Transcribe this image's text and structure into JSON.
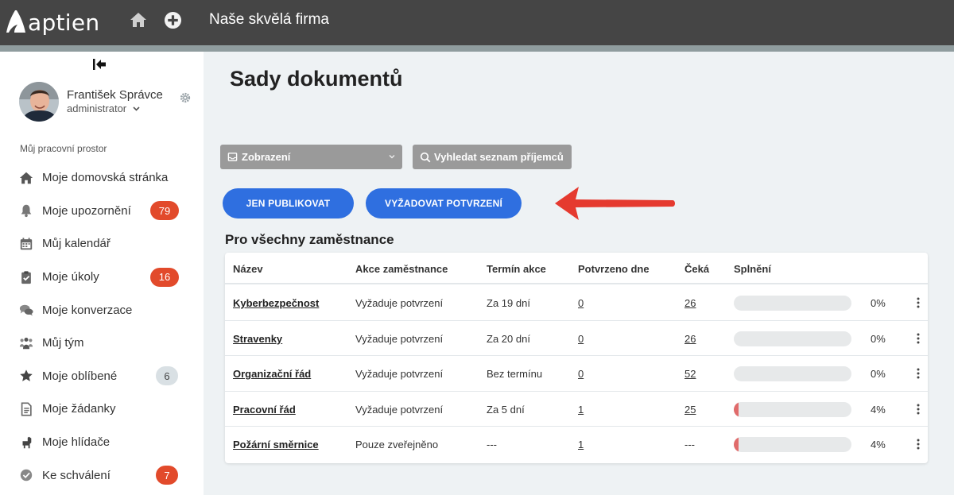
{
  "app": {
    "logo_text": "aptien",
    "company": "Naše skvělá firma"
  },
  "user": {
    "name": "František Správce",
    "role": "administrator"
  },
  "sidebar": {
    "workspace_label": "Můj pracovní prostor",
    "items": [
      {
        "label": "Moje domovská stránka",
        "icon": "home-icon",
        "badge": ""
      },
      {
        "label": "Moje upozornění",
        "icon": "bell-icon",
        "badge": "79",
        "badge_color": "#e24a2b"
      },
      {
        "label": "Můj kalendář",
        "icon": "calendar-icon",
        "badge": ""
      },
      {
        "label": "Moje úkoly",
        "icon": "clipboard-icon",
        "badge": "16",
        "badge_color": "#e24a2b"
      },
      {
        "label": "Moje konverzace",
        "icon": "chat-icon",
        "badge": ""
      },
      {
        "label": "Můj tým",
        "icon": "team-icon",
        "badge": ""
      },
      {
        "label": "Moje oblíbené",
        "icon": "star-icon",
        "badge": "6",
        "badge_color": "#d9e0e4"
      },
      {
        "label": "Moje žádanky",
        "icon": "document-icon",
        "badge": ""
      },
      {
        "label": "Moje hlídače",
        "icon": "dog-icon",
        "badge": ""
      },
      {
        "label": "Ke schválení",
        "icon": "check-circle-icon",
        "badge": "7",
        "badge_color": "#e24a2b"
      }
    ]
  },
  "main": {
    "title": "Sady dokumentů",
    "view_select": "Zobrazení",
    "search_placeholder": "Vyhledat seznam příjemců",
    "btn_publish": "JEN PUBLIKOVAT",
    "btn_confirm": "VYŽADOVAT POTVRZENÍ",
    "section_title": "Pro všechny zaměstnance"
  },
  "table": {
    "headers": [
      "Název",
      "Akce zaměstnance",
      "Termín akce",
      "Potvrzeno dne",
      "Čeká",
      "Splnění"
    ],
    "rows": [
      {
        "name": "Kyberbezpečnost",
        "action": "Vyžaduje potvrzení",
        "deadline": "Za 19 dní",
        "confirmed": "0",
        "waiting": "26",
        "progress": 0,
        "pct": "0%"
      },
      {
        "name": "Stravenky",
        "action": "Vyžaduje potvrzení",
        "deadline": "Za 20 dní",
        "confirmed": "0",
        "waiting": "26",
        "progress": 0,
        "pct": "0%"
      },
      {
        "name": "Organizační řád",
        "action": "Vyžaduje potvrzení",
        "deadline": "Bez termínu",
        "confirmed": "0",
        "waiting": "52",
        "progress": 0,
        "pct": "0%"
      },
      {
        "name": "Pracovní řád",
        "action": "Vyžaduje potvrzení",
        "deadline": "Za 5 dní",
        "confirmed": "1",
        "waiting": "25",
        "progress": 4,
        "pct": "4%"
      },
      {
        "name": "Požární směrnice",
        "action": "Pouze zveřejněno",
        "deadline": "---",
        "confirmed": "1",
        "waiting": "---",
        "progress": 4,
        "pct": "4%"
      }
    ]
  },
  "colors": {
    "topbar": "#454545",
    "primary_button": "#2f6fe0",
    "badge_red": "#e24a2b",
    "arrow": "#e53a2f",
    "progress_fill": "#e06b6b"
  }
}
